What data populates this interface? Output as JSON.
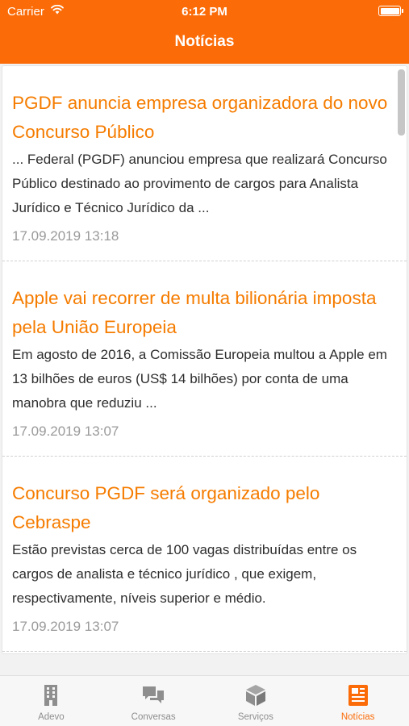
{
  "status_bar": {
    "carrier": "Carrier",
    "time": "6:12 PM"
  },
  "nav": {
    "title": "Notícias"
  },
  "news": [
    {
      "title": "PGDF anuncia empresa organizadora do novo Concurso Público",
      "excerpt": "... Federal (PGDF) anunciou empresa que realizará Concurso Público destinado ao provimento de cargos para Analista Jurídico e Técnico Jurídico da ...",
      "date": "17.09.2019 13:18"
    },
    {
      "title": "Apple vai recorrer de multa bilionária imposta pela União Europeia",
      "excerpt": "Em agosto de 2016, a Comissão Europeia multou a Apple em 13 bilhões de euros (US$ 14 bilhões) por conta de uma manobra que reduziu ...",
      "date": "17.09.2019 13:07"
    },
    {
      "title": "Concurso PGDF será organizado pelo Cebraspe",
      "excerpt": "Estão previstas cerca de 100 vagas distribuídas entre os cargos de analista e técnico jurídico , que exigem, respectivamente, níveis superior e médio.",
      "date": "17.09.2019 13:07"
    }
  ],
  "tabs": [
    {
      "label": "Adevo",
      "icon": "building-icon"
    },
    {
      "label": "Conversas",
      "icon": "chat-bubbles-icon"
    },
    {
      "label": "Serviços",
      "icon": "cube-icon"
    },
    {
      "label": "Notícias",
      "icon": "news-icon"
    }
  ],
  "colors": {
    "accent": "#fb6c09",
    "title": "#f57c00",
    "inactive_tab": "#8e8e8e"
  }
}
